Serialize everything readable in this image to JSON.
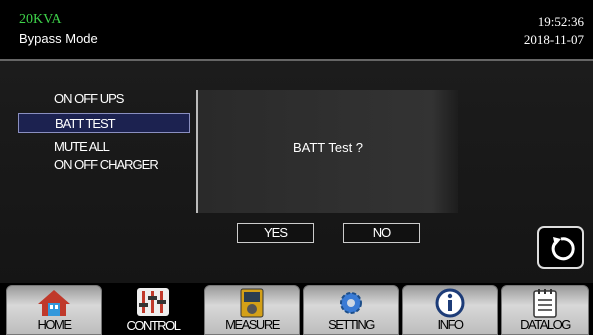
{
  "header": {
    "model": "20KVA",
    "mode": "Bypass Mode",
    "time": "19:52:36",
    "date": "2018-11-07"
  },
  "control_menu": {
    "items": [
      {
        "label": "ON OFF UPS"
      },
      {
        "label": "BATT TEST",
        "selected": true
      },
      {
        "label": "MUTE ALL"
      },
      {
        "label": "ON OFF CHARGER"
      }
    ]
  },
  "dialog": {
    "message": "BATT Test ?",
    "yes_label": "YES",
    "no_label": "NO"
  },
  "refresh_icon": "refresh-icon",
  "nav": {
    "tabs": [
      {
        "label": "HOME",
        "icon": "home-icon"
      },
      {
        "label": "CONTROL",
        "icon": "sliders-icon",
        "active": true
      },
      {
        "label": "MEASURE",
        "icon": "meter-icon"
      },
      {
        "label": "SETTING",
        "icon": "gear-icon"
      },
      {
        "label": "INFO",
        "icon": "info-icon"
      },
      {
        "label": "DATALOG",
        "icon": "log-icon"
      }
    ]
  },
  "colors": {
    "model_text": "#3ed24a",
    "selected_item_bg": "#1c2250",
    "background": "#000000"
  }
}
